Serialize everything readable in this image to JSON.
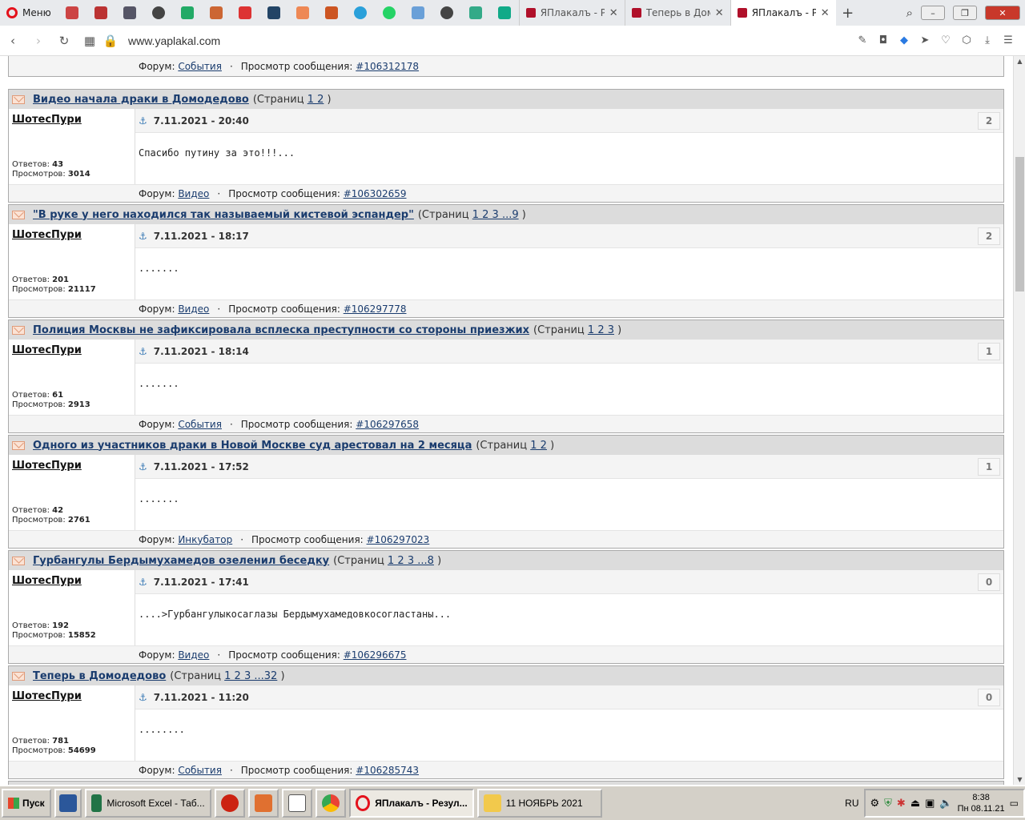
{
  "browser": {
    "menu_label": "Меню",
    "tabs": [
      {
        "title": "ЯПлакалъ - Рез"
      },
      {
        "title": "Теперь в Домо"
      },
      {
        "title": "ЯПлакалъ - Рез"
      }
    ],
    "url": "www.yaplakal.com"
  },
  "top_footer": {
    "forum_label": "Форум:",
    "forum": "События",
    "view_label": "Просмотр сообщения:",
    "msg_id": "#106312178"
  },
  "posts": [
    {
      "title": "Видео начала драки в Домодедово",
      "pages_prefix": "(Страниц",
      "pages": "1 2",
      "pages_suffix": ")",
      "author": "ШотесПури",
      "date": "7.11.2021 - 20:40",
      "count": "2",
      "replies_label": "Ответов:",
      "replies": "43",
      "views_label": "Просмотров:",
      "views": "3014",
      "snippet": "Спасибо путину за это!!!...",
      "forum_label": "Форум:",
      "forum": "Видео",
      "view_label": "Просмотр сообщения:",
      "msg_id": "#106302659"
    },
    {
      "title": "\"В руке у него находился так называемый кистевой эспандер\"",
      "pages_prefix": "(Страниц",
      "pages": "1 2 3 ...9",
      "pages_suffix": ")",
      "author": "ШотесПури",
      "date": "7.11.2021 - 18:17",
      "count": "2",
      "replies_label": "Ответов:",
      "replies": "201",
      "views_label": "Просмотров:",
      "views": "21117",
      "snippet": ".......",
      "forum_label": "Форум:",
      "forum": "Видео",
      "view_label": "Просмотр сообщения:",
      "msg_id": "#106297778"
    },
    {
      "title": "Полиция Москвы не зафиксировала всплеска преступности со стороны приезжих",
      "pages_prefix": "(Страниц",
      "pages": "1 2 3",
      "pages_suffix": ")",
      "author": "ШотесПури",
      "date": "7.11.2021 - 18:14",
      "count": "1",
      "replies_label": "Ответов:",
      "replies": "61",
      "views_label": "Просмотров:",
      "views": "2913",
      "snippet": ".......",
      "forum_label": "Форум:",
      "forum": "События",
      "view_label": "Просмотр сообщения:",
      "msg_id": "#106297658"
    },
    {
      "title": "Одного из участников драки в Новой Москве суд арестовал на 2 месяца",
      "pages_prefix": "(Страниц",
      "pages": "1 2",
      "pages_suffix": ")",
      "author": "ШотесПури",
      "date": "7.11.2021 - 17:52",
      "count": "1",
      "replies_label": "Ответов:",
      "replies": "42",
      "views_label": "Просмотров:",
      "views": "2761",
      "snippet": ".......",
      "forum_label": "Форум:",
      "forum": "Инкубатор",
      "view_label": "Просмотр сообщения:",
      "msg_id": "#106297023"
    },
    {
      "title": "Гурбангулы Бердымухамедов озеленил беседку",
      "pages_prefix": "(Страниц",
      "pages": "1 2 3 ...8",
      "pages_suffix": ")",
      "author": "ШотесПури",
      "date": "7.11.2021 - 17:41",
      "count": "0",
      "replies_label": "Ответов:",
      "replies": "192",
      "views_label": "Просмотров:",
      "views": "15852",
      "snippet": "....>Гурбангулыкосаглазы Бердымухамедовкосогластаны...",
      "forum_label": "Форум:",
      "forum": "Видео",
      "view_label": "Просмотр сообщения:",
      "msg_id": "#106296675"
    },
    {
      "title": "Теперь в Домодедово",
      "pages_prefix": "(Страниц",
      "pages": "1 2 3 ...32",
      "pages_suffix": ")",
      "author": "ШотесПури",
      "date": "7.11.2021 - 11:20",
      "count": "0",
      "replies_label": "Ответов:",
      "replies": "781",
      "views_label": "Просмотров:",
      "views": "54699",
      "snippet": "........",
      "forum_label": "Форум:",
      "forum": "События",
      "view_label": "Просмотр сообщения:",
      "msg_id": "#106285743"
    }
  ],
  "taskbar": {
    "start_label": "Пуск",
    "items": [
      {
        "label": "Microsoft Excel - Таб..."
      },
      {
        "label": "ЯПлакалъ - Резул..."
      },
      {
        "label": "11 НОЯБРЬ 2021"
      }
    ],
    "lang": "RU",
    "time": "8:38",
    "date": "Пн 08.11.21"
  }
}
